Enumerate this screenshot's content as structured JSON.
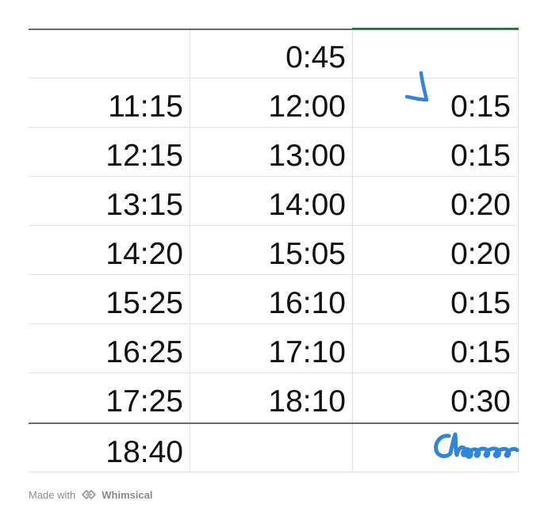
{
  "table": {
    "rows": [
      [
        "",
        "0:45",
        ""
      ],
      [
        "11:15",
        "12:00",
        "0:15"
      ],
      [
        "12:15",
        "13:00",
        "0:15"
      ],
      [
        "13:15",
        "14:00",
        "0:20"
      ],
      [
        "14:20",
        "15:05",
        "0:20"
      ],
      [
        "15:25",
        "16:10",
        "0:15"
      ],
      [
        "16:25",
        "17:10",
        "0:15"
      ],
      [
        "17:25",
        "18:10",
        "0:30"
      ],
      [
        "18:40",
        "",
        ""
      ]
    ]
  },
  "annotations": {
    "check_icon": "checkmark-icon",
    "signature_icon": "handwritten-signature",
    "ink_color": "#2f86d6"
  },
  "footer": {
    "made_with": "Made with",
    "brand": "Whimsical",
    "logo_icon": "whimsical-logo-icon"
  },
  "colors": {
    "grid": "#e3e3e3",
    "selected_border": "#1f7a3a",
    "text": "#111111"
  }
}
